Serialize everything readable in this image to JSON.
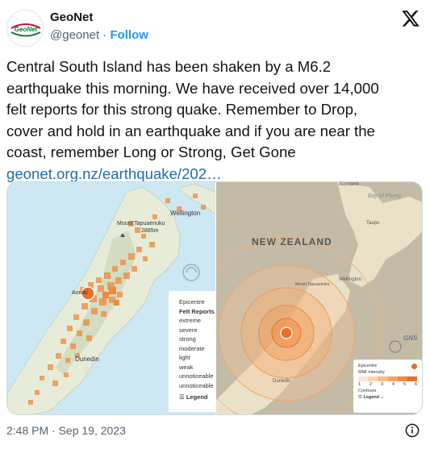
{
  "account": {
    "display_name": "GeoNet",
    "handle": "@geonet",
    "separator": " · ",
    "follow_label": "Follow",
    "avatar_text": "GeoNet",
    "avatar_color": "#0e7a3a"
  },
  "tweet": {
    "lines": [
      "Central South Island has been shaken by a M6.2",
      "earthquake this morning. We have received over 14,000",
      "felt reports for this strong quake. Remember to Drop,",
      "cover and hold in an earthquake and if you are near the",
      "coast, remember Long or Strong, Get Gone"
    ],
    "link_text": "geonet.org.nz/earthquake/202…",
    "timestamp": "2:48 PM · Sep 19, 2023"
  },
  "map_left": {
    "labels": {
      "mount": "Mount Tapuaenuku",
      "mount_height": "2885m",
      "wellington": "Wellington",
      "aoraki": "Aoraki",
      "dunedin": "Dunedin"
    },
    "legend": {
      "epicentre": "Epicentre",
      "felt_reports": "Felt Reports",
      "levels": [
        "extreme",
        "severe",
        "strong",
        "moderate",
        "light",
        "weak",
        "unnoticeable",
        "unnoticeable"
      ],
      "toggle": "Legend"
    }
  },
  "map_right": {
    "labels": {
      "country": "NEW ZEALAND",
      "auckland": "Auckland",
      "bay": "Bay of Plenty",
      "taupo": "Taupo",
      "wellington": "Wellington",
      "dunedin": "Dunedin",
      "mount": "Mount Tapuaenuku",
      "gns": "GNS"
    },
    "legend": {
      "epicentre": "Epicentre",
      "mmi": "MMI Intensity",
      "scale": [
        "1",
        "2",
        "3",
        "4",
        "5",
        "6"
      ],
      "contours": "Contours",
      "toggle": "Legend"
    }
  },
  "colors": {
    "accent": "#1d9bf0",
    "link": "#1d6cab",
    "report_orange": "#f08a3a",
    "epicentre": "#e8702a"
  }
}
